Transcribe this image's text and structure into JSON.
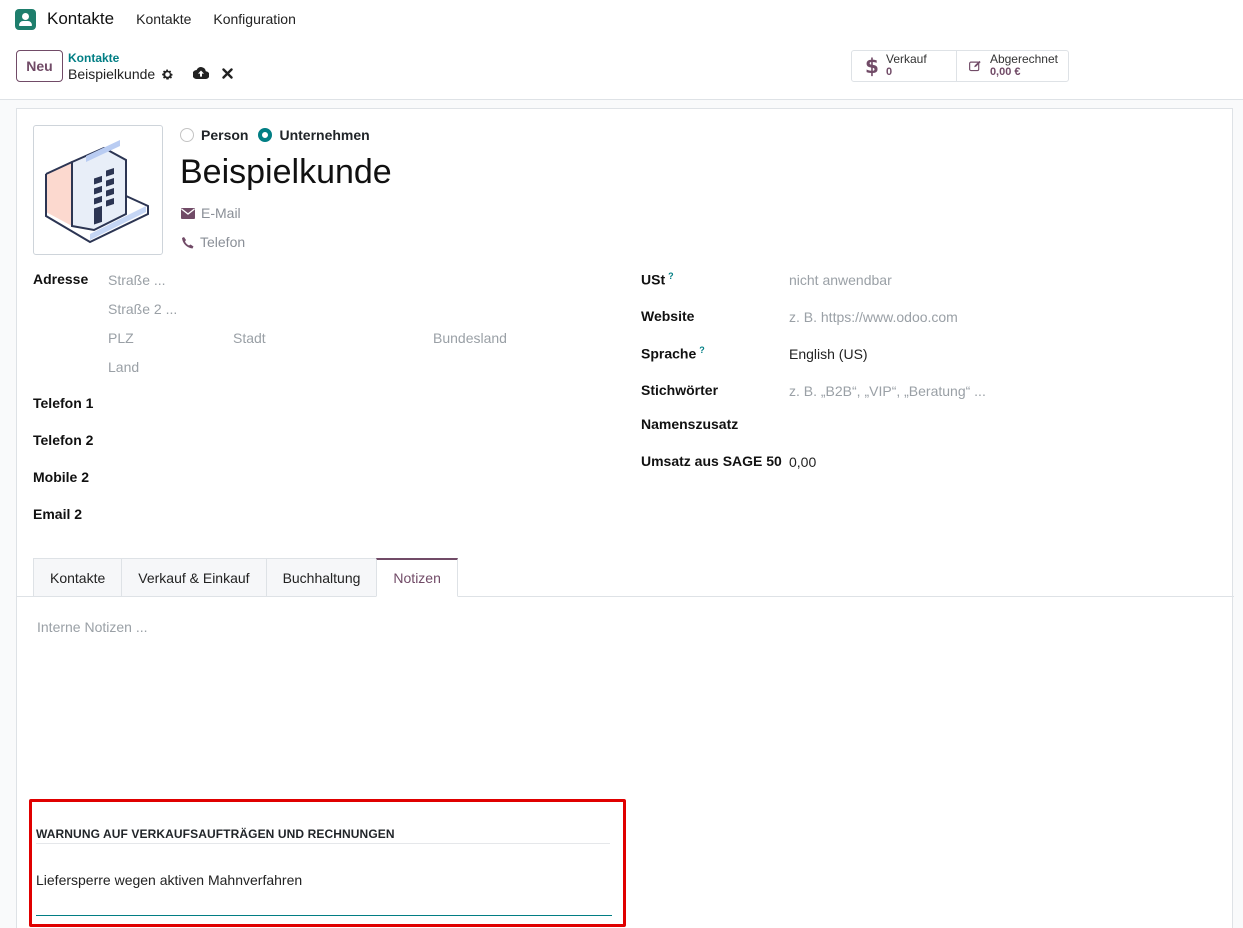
{
  "topnav": {
    "app_name": "Kontakte",
    "menu": [
      "Kontakte",
      "Konfiguration"
    ]
  },
  "control": {
    "new_label": "Neu",
    "breadcrumb_parent": "Kontakte",
    "breadcrumb_current": "Beispielkunde",
    "stats": [
      {
        "label": "Verkauf",
        "value": "0"
      },
      {
        "label": "Abgerechnet",
        "value": "0,00 €"
      }
    ]
  },
  "form": {
    "radio_person": "Person",
    "radio_company": "Unternehmen",
    "selected_type": "Unternehmen",
    "name": "Beispielkunde",
    "email_placeholder": "E-Mail",
    "phone_placeholder": "Telefon",
    "left": {
      "address_label": "Adresse",
      "street_ph": "Straße ...",
      "street2_ph": "Straße 2 ...",
      "zip_ph": "PLZ",
      "city_ph": "Stadt",
      "state_ph": "Bundesland",
      "country_ph": "Land",
      "phone1_label": "Telefon 1",
      "phone2_label": "Telefon 2",
      "mobile2_label": "Mobile 2",
      "email2_label": "Email 2"
    },
    "right": {
      "vat_label": "USt",
      "vat_ph": "nicht anwendbar",
      "website_label": "Website",
      "website_ph": "z. B. https://www.odoo.com",
      "lang_label": "Sprache",
      "lang_value": "English (US)",
      "tags_label": "Stichwörter",
      "tags_ph": "z. B. „B2B“, „VIP“, „Beratung“ ...",
      "suffix_label": "Namenszusatz",
      "sage_label": "Umsatz aus SAGE 50",
      "sage_value": "0,00",
      "help_mark": "?"
    },
    "tabs": [
      "Kontakte",
      "Verkauf & Einkauf",
      "Buchhaltung",
      "Notizen"
    ],
    "active_tab": "Notizen",
    "notes_ph": "Interne Notizen ...",
    "warning": {
      "title": "WARNUNG AUF VERKAUFSAUFTRÄGEN UND RECHNUNGEN",
      "text": "Liefersperre wegen aktiven Mahnverfahren"
    }
  },
  "colors": {
    "brand": "#714b67",
    "accent": "#017e84",
    "highlight": "#e00000"
  }
}
